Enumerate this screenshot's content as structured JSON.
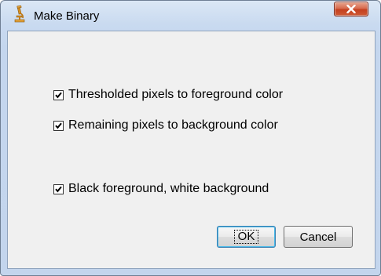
{
  "window": {
    "title": "Make Binary",
    "close_icon": "close-x-icon",
    "app_icon": "microscope-icon"
  },
  "options": [
    {
      "label": "Thresholded pixels to foreground color",
      "checked": true
    },
    {
      "label": "Remaining pixels to background color",
      "checked": true
    },
    {
      "label": "Black foreground, white background",
      "checked": true
    }
  ],
  "buttons": {
    "ok_label": "OK",
    "cancel_label": "Cancel"
  },
  "colors": {
    "frame": "#c4d6ee",
    "client_bg": "#f0f0f0",
    "close_button": "#c4401f",
    "focus_border": "#48b9e8"
  }
}
